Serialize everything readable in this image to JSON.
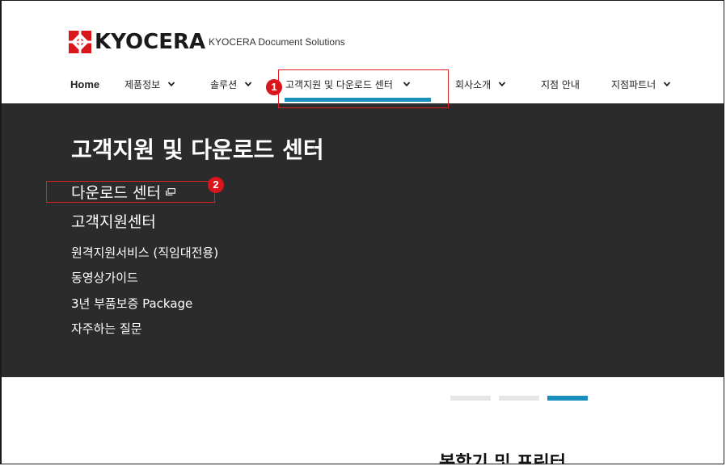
{
  "brand": {
    "logo_text": "KYOCERA",
    "tagline": "KYOCERA Document Solutions",
    "logo_color": "#d8161b"
  },
  "nav": {
    "items": [
      {
        "label": "Home",
        "has_dropdown": false
      },
      {
        "label": "제품정보",
        "has_dropdown": true
      },
      {
        "label": "솔루션",
        "has_dropdown": true
      },
      {
        "label": "고객지원 및 다운로드 센터",
        "has_dropdown": true,
        "active": true
      },
      {
        "label": "회사소개",
        "has_dropdown": true
      },
      {
        "label": "지점 안내",
        "has_dropdown": false
      },
      {
        "label": "지점파트너",
        "has_dropdown": true
      }
    ],
    "active_color": "#1a8fbe"
  },
  "mega_menu": {
    "title": "고객지원 및 다운로드 센터",
    "primary_links": [
      {
        "label": "다운로드 센터",
        "external": true
      },
      {
        "label": "고객지원센터",
        "external": false
      }
    ],
    "secondary_links": [
      {
        "label": "원격지원서비스 (직임대전용)"
      },
      {
        "label": "동영상가이드"
      },
      {
        "label": "3년 부품보증 Package"
      },
      {
        "label": "자주하는 질문"
      }
    ],
    "background": "#2b2b2b"
  },
  "annotations": {
    "badge_1": "1",
    "badge_2": "2",
    "color": "#e02020"
  },
  "carousel": {
    "slide_count": 3,
    "active_index": 2,
    "inactive_color": "#e6e6e6",
    "active_color": "#1a8fbe"
  },
  "below_fold": {
    "partial_heading": "복합기 및 프린터"
  }
}
